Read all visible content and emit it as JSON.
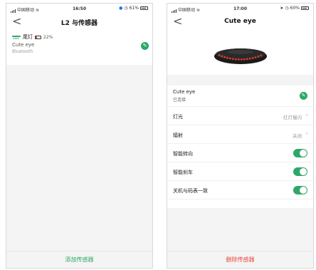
{
  "colors": {
    "accent_green": "#2ea866",
    "danger_red": "#e8473c",
    "background_gray": "#f4f4f4"
  },
  "left_screen": {
    "status": {
      "carrier": "中国移动",
      "time": "16:50",
      "battery": "61%"
    },
    "nav": {
      "back": "<",
      "title": "L2 与传感器"
    },
    "device": {
      "type_label": "尾灯",
      "battery": "22%",
      "name": "Cute eye",
      "connection": "Bluetooth",
      "edit_icon": "pencil-icon"
    },
    "bottom_button": "添加传感器"
  },
  "right_screen": {
    "status": {
      "carrier": "中国移动",
      "time": "17:00",
      "battery": "60%"
    },
    "nav": {
      "back": "<",
      "title": "Cute eye"
    },
    "device": {
      "name": "Cute eye",
      "status": "已连接",
      "edit_icon": "pencil-icon"
    },
    "rows": [
      {
        "label": "灯光",
        "value": "红灯慢闪",
        "type": "chevron"
      },
      {
        "label": "辐射",
        "value": "关闭",
        "type": "chevron"
      },
      {
        "label": "智能转向",
        "type": "toggle",
        "on": true
      },
      {
        "label": "智能刹车",
        "type": "toggle",
        "on": true
      },
      {
        "label": "关机与码表一致",
        "type": "toggle",
        "on": true
      }
    ],
    "bottom_button": "删除传感器"
  }
}
